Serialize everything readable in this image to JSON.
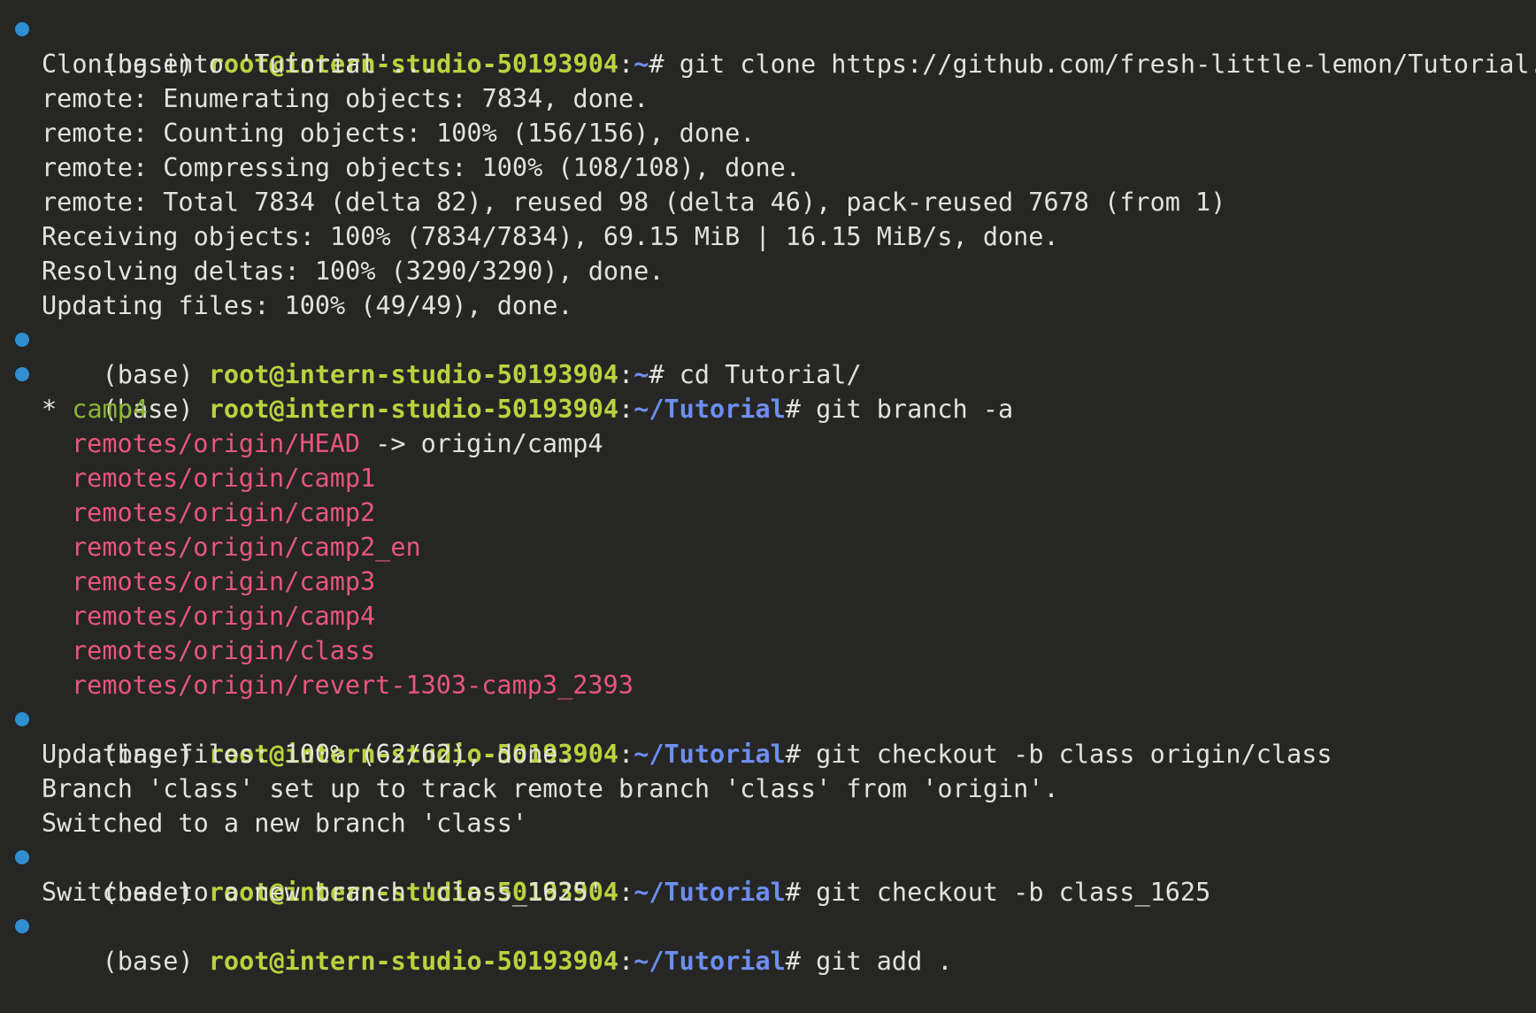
{
  "colors": {
    "background": "#262624",
    "text": "#e3e3dc",
    "prompt_user": "#b9d33f",
    "prompt_path": "#6e8ef0",
    "current_branch": "#8cb536",
    "remote_branch": "#e8577c",
    "command_marker": "#2f8fd0"
  },
  "prompt": {
    "env": "(base) ",
    "user_host": "root@intern-studio-50193904",
    "colon": ":",
    "home": "~",
    "tutorial": "~/Tutorial",
    "hash": "# "
  },
  "commands": [
    "git clone https://github.com/fresh-little-lemon/Tutorial.git",
    "cd Tutorial/",
    "git branch -a",
    "git checkout -b class origin/class",
    "git checkout -b class_1625",
    "git add ."
  ],
  "clone_output": [
    "Cloning into 'Tutorial'...",
    "remote: Enumerating objects: 7834, done.",
    "remote: Counting objects: 100% (156/156), done.",
    "remote: Compressing objects: 100% (108/108), done.",
    "remote: Total 7834 (delta 82), reused 98 (delta 46), pack-reused 7678 (from 1)",
    "Receiving objects: 100% (7834/7834), 69.15 MiB | 16.15 MiB/s, done.",
    "Resolving deltas: 100% (3290/3290), done.",
    "Updating files: 100% (49/49), done."
  ],
  "branches": {
    "current_marker": "* ",
    "current": "camp4",
    "head_ref": "remotes/origin/HEAD",
    "head_arrow": " -> origin/camp4",
    "remotes": [
      "remotes/origin/camp1",
      "remotes/origin/camp2",
      "remotes/origin/camp2_en",
      "remotes/origin/camp3",
      "remotes/origin/camp4",
      "remotes/origin/class",
      "remotes/origin/revert-1303-camp3_2393"
    ]
  },
  "checkout_class_output": [
    "Updating files: 100% (62/62), done.",
    "Branch 'class' set up to track remote branch 'class' from 'origin'.",
    "Switched to a new branch 'class'"
  ],
  "checkout_class_1625_output": [
    "Switched to a new branch 'class_1625'"
  ]
}
